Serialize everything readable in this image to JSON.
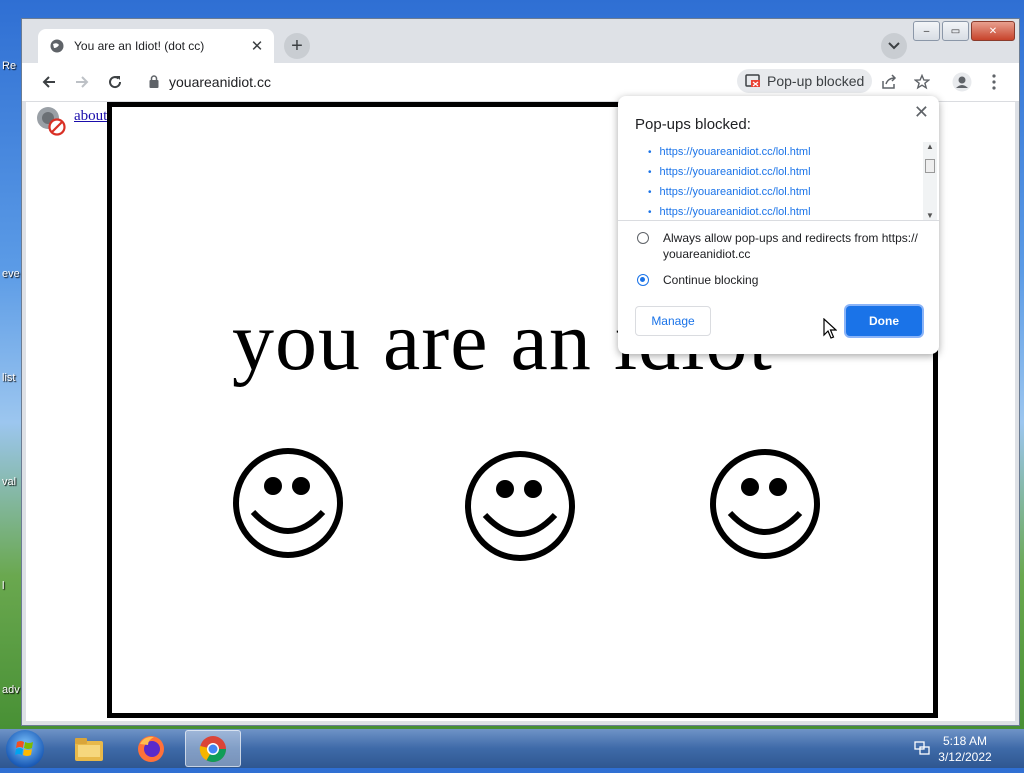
{
  "desktop": {
    "labels": [
      "Re",
      "eve",
      "list",
      "val",
      "l",
      "adv"
    ]
  },
  "browser": {
    "tab": {
      "title": "You are an Idiot! (dot cc)"
    },
    "toolbar": {
      "url": "youareanidiot.cc",
      "popup_chip": "Pop-up blocked"
    },
    "page": {
      "flash_link": "about flash",
      "headline": "you are an idiot"
    }
  },
  "popup_bubble": {
    "title": "Pop-ups blocked:",
    "blocked_urls": [
      "https://youareanidiot.cc/lol.html",
      "https://youareanidiot.cc/lol.html",
      "https://youareanidiot.cc/lol.html",
      "https://youareanidiot.cc/lol.html"
    ],
    "option_allow_line1": "Always allow pop-ups and redirects from https://",
    "option_allow_line2": "youareanidiot.cc",
    "option_block": "Continue blocking",
    "selected_option": "Continue blocking",
    "manage_label": "Manage",
    "done_label": "Done"
  },
  "taskbar": {
    "time": "5:18 AM",
    "date": "3/12/2022"
  },
  "colors": {
    "accent": "#1a73e8",
    "link": "#1a0dab"
  }
}
